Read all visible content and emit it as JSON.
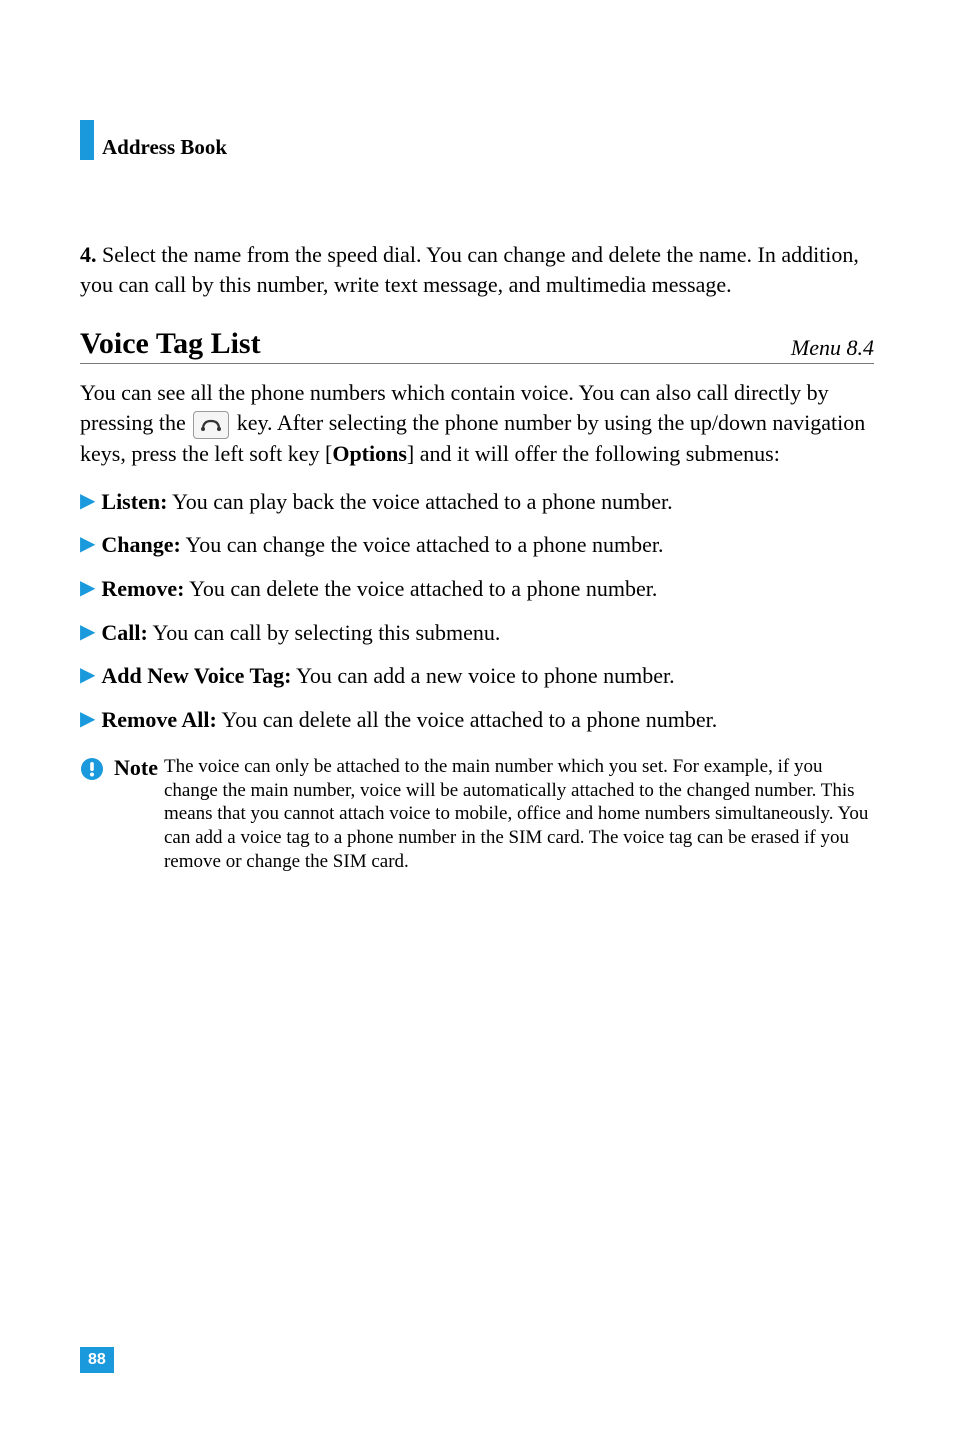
{
  "header": {
    "section_title": "Address Book"
  },
  "step": {
    "number": "4.",
    "text": "Select the name from the speed dial. You can change and delete the name. In addition, you can call by this number, write text message, and multimedia message."
  },
  "h2": {
    "title": "Voice Tag List",
    "menu": "Menu 8.4"
  },
  "intro": {
    "part1": "You can see all the phone numbers which contain voice. You can also call directly by pressing the",
    "part2": "key. After selecting the phone number by using the up/down navigation keys, press the left soft key [",
    "bold": "Options",
    "part3": "] and it will offer the following submenus:"
  },
  "bullets": [
    {
      "label": "Listen:",
      "text": " You can play back the voice attached to a phone number."
    },
    {
      "label": "Change:",
      "text": " You can change the voice attached to a phone number."
    },
    {
      "label": "Remove:",
      "text": " You can delete the voice attached to a phone number."
    },
    {
      "label": "Call:",
      "text": " You can call by selecting this submenu."
    },
    {
      "label": "Add New Voice Tag:",
      "text": " You can add a new voice to phone number."
    },
    {
      "label": "Remove All:",
      "text": " You can delete all the voice attached to a phone number."
    }
  ],
  "note": {
    "label": "Note",
    "text": "The voice can only be attached to the main number which you set. For example, if you change the main number, voice will be automatically attached to the changed number. This means that you cannot attach voice to mobile, office and home numbers simultaneously. You can add a voice tag to a phone number in the SIM card. The voice tag can be erased if you remove or change the SIM card."
  },
  "page_number": "88",
  "colors": {
    "accent": "#1a9add"
  }
}
